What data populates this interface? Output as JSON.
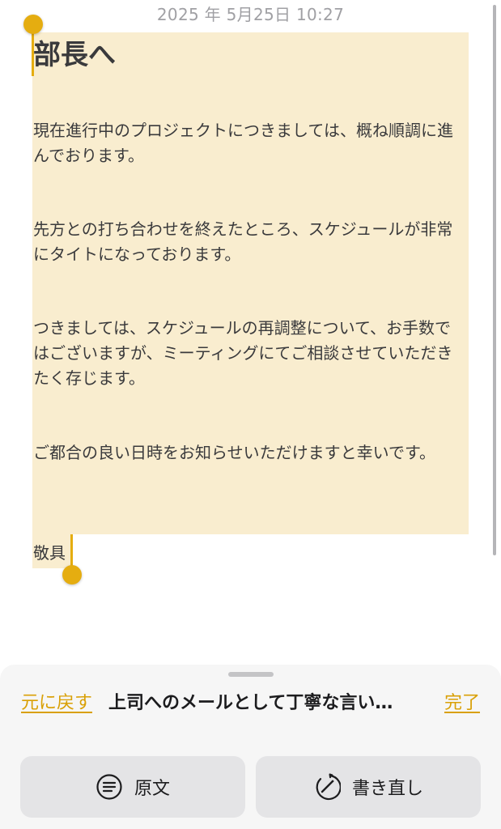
{
  "status": {
    "timestamp": "2025 年 5月25日 10:27"
  },
  "note": {
    "heading": "部長へ",
    "paragraphs": [
      "現在進行中のプロジェクトにつきましては、概ね順調に進んでおります。",
      "先方との打ち合わせを終えたところ、スケジュールが非常にタイトになっております。",
      "つきましては、スケジュールの再調整について、お手数ではございますが、ミーティングにてご相談させていただきたく存じます。",
      "ご都合の良い日時をお知らせいただけますと幸いです。",
      "敬具"
    ]
  },
  "writing_tools": {
    "undo_label": "元に戻す",
    "prompt": "上司へのメールとして丁寧な言い…",
    "done_label": "完了",
    "buttons": [
      {
        "label": "原文",
        "icon": "list-circle-icon"
      },
      {
        "label": "書き直し",
        "icon": "rewrite-circle-icon"
      }
    ]
  },
  "colors": {
    "accent": "#e5ad10",
    "selection": "#f9edcf",
    "panel_background": "#f6f6f6",
    "button_background": "#e4e4e6"
  }
}
